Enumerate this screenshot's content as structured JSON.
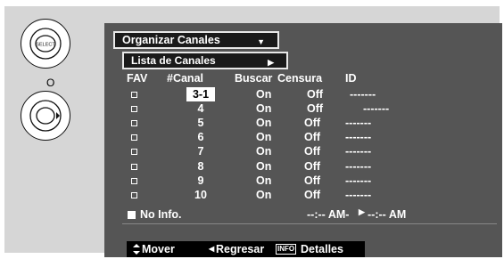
{
  "remote": {
    "select_label": "SELECT",
    "or_label": "O"
  },
  "menu": {
    "title": "Organizar Canales",
    "submenu": "Lista de Canales"
  },
  "table": {
    "headers": [
      "FAV",
      "#Canal",
      "Buscar",
      "Censura",
      "ID"
    ],
    "rows": [
      {
        "channel": "3-1",
        "search": "On",
        "censor": "Off",
        "id": "-------",
        "selected": true
      },
      {
        "channel": "4",
        "search": "On",
        "censor": "Off",
        "id": "-------"
      },
      {
        "channel": "5",
        "search": "On",
        "censor": "Off",
        "id": "-------"
      },
      {
        "channel": "6",
        "search": "On",
        "censor": "Off",
        "id": "-------"
      },
      {
        "channel": "7",
        "search": "On",
        "censor": "Off",
        "id": "-------"
      },
      {
        "channel": "8",
        "search": "On",
        "censor": "Off",
        "id": "-------"
      },
      {
        "channel": "9",
        "search": "On",
        "censor": "Off",
        "id": "-------"
      },
      {
        "channel": "10",
        "search": "On",
        "censor": "Off",
        "id": "-------"
      }
    ]
  },
  "info": {
    "no_info": "No Info.",
    "time_start": "--:-- AM-",
    "time_end": "--:-- AM"
  },
  "footer": {
    "move": "Mover",
    "back": "Regresar",
    "info_button": "INFO",
    "details": "Detalles"
  }
}
